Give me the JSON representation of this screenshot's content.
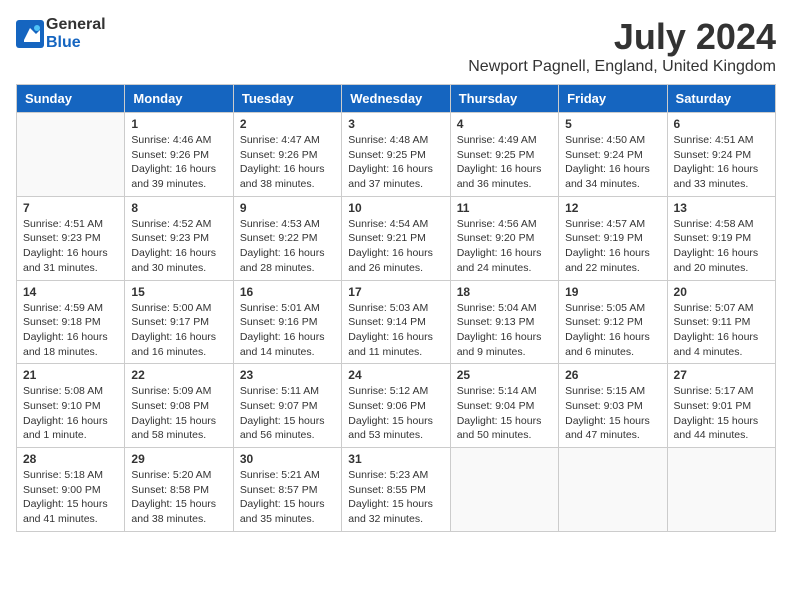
{
  "logo": {
    "general": "General",
    "blue": "Blue"
  },
  "title": "July 2024",
  "subtitle": "Newport Pagnell, England, United Kingdom",
  "days_of_week": [
    "Sunday",
    "Monday",
    "Tuesday",
    "Wednesday",
    "Thursday",
    "Friday",
    "Saturday"
  ],
  "weeks": [
    [
      {
        "day": "",
        "info": ""
      },
      {
        "day": "1",
        "info": "Sunrise: 4:46 AM\nSunset: 9:26 PM\nDaylight: 16 hours\nand 39 minutes."
      },
      {
        "day": "2",
        "info": "Sunrise: 4:47 AM\nSunset: 9:26 PM\nDaylight: 16 hours\nand 38 minutes."
      },
      {
        "day": "3",
        "info": "Sunrise: 4:48 AM\nSunset: 9:25 PM\nDaylight: 16 hours\nand 37 minutes."
      },
      {
        "day": "4",
        "info": "Sunrise: 4:49 AM\nSunset: 9:25 PM\nDaylight: 16 hours\nand 36 minutes."
      },
      {
        "day": "5",
        "info": "Sunrise: 4:50 AM\nSunset: 9:24 PM\nDaylight: 16 hours\nand 34 minutes."
      },
      {
        "day": "6",
        "info": "Sunrise: 4:51 AM\nSunset: 9:24 PM\nDaylight: 16 hours\nand 33 minutes."
      }
    ],
    [
      {
        "day": "7",
        "info": "Sunrise: 4:51 AM\nSunset: 9:23 PM\nDaylight: 16 hours\nand 31 minutes."
      },
      {
        "day": "8",
        "info": "Sunrise: 4:52 AM\nSunset: 9:23 PM\nDaylight: 16 hours\nand 30 minutes."
      },
      {
        "day": "9",
        "info": "Sunrise: 4:53 AM\nSunset: 9:22 PM\nDaylight: 16 hours\nand 28 minutes."
      },
      {
        "day": "10",
        "info": "Sunrise: 4:54 AM\nSunset: 9:21 PM\nDaylight: 16 hours\nand 26 minutes."
      },
      {
        "day": "11",
        "info": "Sunrise: 4:56 AM\nSunset: 9:20 PM\nDaylight: 16 hours\nand 24 minutes."
      },
      {
        "day": "12",
        "info": "Sunrise: 4:57 AM\nSunset: 9:19 PM\nDaylight: 16 hours\nand 22 minutes."
      },
      {
        "day": "13",
        "info": "Sunrise: 4:58 AM\nSunset: 9:19 PM\nDaylight: 16 hours\nand 20 minutes."
      }
    ],
    [
      {
        "day": "14",
        "info": "Sunrise: 4:59 AM\nSunset: 9:18 PM\nDaylight: 16 hours\nand 18 minutes."
      },
      {
        "day": "15",
        "info": "Sunrise: 5:00 AM\nSunset: 9:17 PM\nDaylight: 16 hours\nand 16 minutes."
      },
      {
        "day": "16",
        "info": "Sunrise: 5:01 AM\nSunset: 9:16 PM\nDaylight: 16 hours\nand 14 minutes."
      },
      {
        "day": "17",
        "info": "Sunrise: 5:03 AM\nSunset: 9:14 PM\nDaylight: 16 hours\nand 11 minutes."
      },
      {
        "day": "18",
        "info": "Sunrise: 5:04 AM\nSunset: 9:13 PM\nDaylight: 16 hours\nand 9 minutes."
      },
      {
        "day": "19",
        "info": "Sunrise: 5:05 AM\nSunset: 9:12 PM\nDaylight: 16 hours\nand 6 minutes."
      },
      {
        "day": "20",
        "info": "Sunrise: 5:07 AM\nSunset: 9:11 PM\nDaylight: 16 hours\nand 4 minutes."
      }
    ],
    [
      {
        "day": "21",
        "info": "Sunrise: 5:08 AM\nSunset: 9:10 PM\nDaylight: 16 hours\nand 1 minute."
      },
      {
        "day": "22",
        "info": "Sunrise: 5:09 AM\nSunset: 9:08 PM\nDaylight: 15 hours\nand 58 minutes."
      },
      {
        "day": "23",
        "info": "Sunrise: 5:11 AM\nSunset: 9:07 PM\nDaylight: 15 hours\nand 56 minutes."
      },
      {
        "day": "24",
        "info": "Sunrise: 5:12 AM\nSunset: 9:06 PM\nDaylight: 15 hours\nand 53 minutes."
      },
      {
        "day": "25",
        "info": "Sunrise: 5:14 AM\nSunset: 9:04 PM\nDaylight: 15 hours\nand 50 minutes."
      },
      {
        "day": "26",
        "info": "Sunrise: 5:15 AM\nSunset: 9:03 PM\nDaylight: 15 hours\nand 47 minutes."
      },
      {
        "day": "27",
        "info": "Sunrise: 5:17 AM\nSunset: 9:01 PM\nDaylight: 15 hours\nand 44 minutes."
      }
    ],
    [
      {
        "day": "28",
        "info": "Sunrise: 5:18 AM\nSunset: 9:00 PM\nDaylight: 15 hours\nand 41 minutes."
      },
      {
        "day": "29",
        "info": "Sunrise: 5:20 AM\nSunset: 8:58 PM\nDaylight: 15 hours\nand 38 minutes."
      },
      {
        "day": "30",
        "info": "Sunrise: 5:21 AM\nSunset: 8:57 PM\nDaylight: 15 hours\nand 35 minutes."
      },
      {
        "day": "31",
        "info": "Sunrise: 5:23 AM\nSunset: 8:55 PM\nDaylight: 15 hours\nand 32 minutes."
      },
      {
        "day": "",
        "info": ""
      },
      {
        "day": "",
        "info": ""
      },
      {
        "day": "",
        "info": ""
      }
    ]
  ]
}
